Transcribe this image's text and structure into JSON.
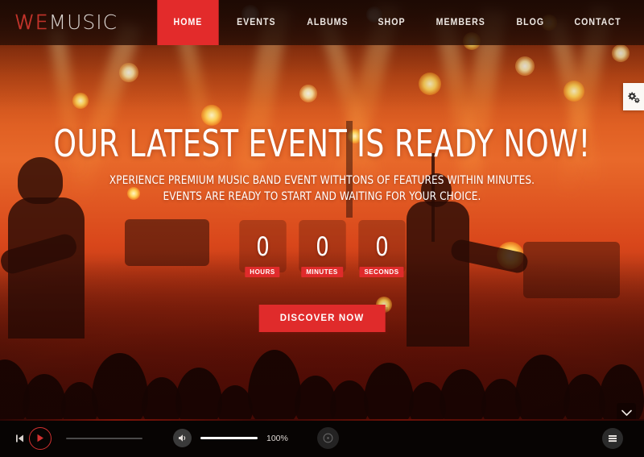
{
  "brand": {
    "logo_we": "WE",
    "logo_music": "MUSIC",
    "accent_color": "#e32b2b"
  },
  "nav": {
    "items": [
      {
        "label": "HOME",
        "active": true
      },
      {
        "label": "EVENTS",
        "active": false
      },
      {
        "label": "ALBUMS",
        "active": false
      },
      {
        "label": "SHOP",
        "active": false
      },
      {
        "label": "MEMBERS",
        "active": false
      },
      {
        "label": "BLOG",
        "active": false
      },
      {
        "label": "CONTACT",
        "active": false
      }
    ],
    "cart_icon": "shopping-cart-icon"
  },
  "hero": {
    "title": "OUR LATEST EVENT IS READY NOW!",
    "subtitle": "XPERIENCE PREMIUM MUSIC BAND EVENT WITHTONS OF FEATURES WITHIN MINUTES. EVENTS ARE READY TO START AND WAITING FOR YOUR CHOICE.",
    "cta_label": "DISCOVER NOW",
    "scroll_icon": "chevron-down-icon"
  },
  "countdown": {
    "units": [
      {
        "value": "0",
        "label": "HOURS"
      },
      {
        "value": "0",
        "label": "MINUTES"
      },
      {
        "value": "0",
        "label": "SECONDS"
      }
    ]
  },
  "settings": {
    "icon": "gears-icon"
  },
  "player": {
    "prev_icon": "skip-previous-icon",
    "play_icon": "play-icon",
    "progress_percent": 0,
    "volume_icon": "volume-icon",
    "volume_percent": 100,
    "volume_label": "100%",
    "repeat_icon": "repeat-icon",
    "playlist_icon": "playlist-icon"
  }
}
